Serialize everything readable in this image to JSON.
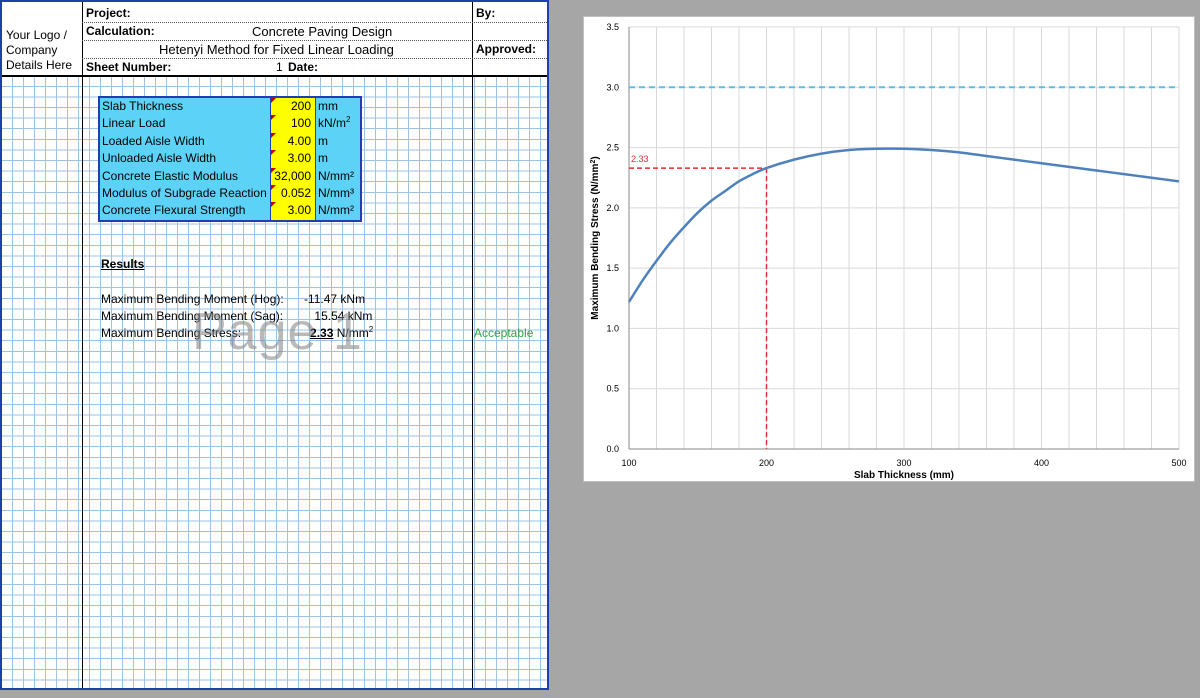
{
  "header": {
    "project_label": "Project:",
    "calculation_label": "Calculation:",
    "calculation_title": "Concrete Paving Design",
    "calculation_subtitle": "Hetenyi Method for Fixed Linear Loading",
    "sheet_number_label": "Sheet Number:",
    "sheet_number": "1",
    "date_label": "Date:",
    "by_label": "By:",
    "approved_label": "Approved:",
    "logo_lines": [
      "Your Logo /",
      "Company",
      "Details Here"
    ]
  },
  "inputs": [
    {
      "label": "Slab Thickness",
      "value": "200",
      "unit": "mm"
    },
    {
      "label": "Linear Load",
      "value": "100",
      "unit": "kN/m",
      "unit_sup": "2"
    },
    {
      "label": "Loaded Aisle Width",
      "value": "4.00",
      "unit": "m"
    },
    {
      "label": "Unloaded Aisle Width",
      "value": "3.00",
      "unit": "m"
    },
    {
      "label": "Concrete Elastic Modulus",
      "value": "32,000",
      "unit": "N/mm²"
    },
    {
      "label": "Modulus of Subgrade Reaction",
      "value": "0.052",
      "unit": "N/mm³"
    },
    {
      "label": "Concrete Flexural Strength",
      "value": "3.00",
      "unit": "N/mm²"
    }
  ],
  "results": {
    "title": "Results",
    "rows": [
      {
        "label": "Maximum Bending Moment (Hog):",
        "value": "-11.47",
        "unit": "kNm"
      },
      {
        "label": "Maximum Bending Moment (Sag):",
        "value": "15.54",
        "unit": "kNm"
      },
      {
        "label": "Maximum Bending Stress:",
        "value": "2.33",
        "unit": "N/mm",
        "unit_sup": "2"
      }
    ],
    "status": "Acceptable",
    "status_color": "#2ca24a"
  },
  "watermark": "Page 1",
  "chart_data": {
    "type": "line",
    "xlabel": "Slab Thickness  (mm)",
    "ylabel": "Maximum Bending Stress (N/mm",
    "ylabel_sup": "2",
    "ylabel_suffix": ")",
    "xlim": [
      100,
      500
    ],
    "ylim": [
      0,
      3.5
    ],
    "x_ticks": [
      "100",
      "200",
      "300",
      "400",
      "500"
    ],
    "y_ticks": [
      "0.0",
      "0.5",
      "1.0",
      "1.5",
      "2.0",
      "2.5",
      "3.0",
      "3.5"
    ],
    "grid": true,
    "series": [
      {
        "color": "#4f81bd",
        "x": [
          100,
          110,
          120,
          130,
          140,
          150,
          160,
          170,
          180,
          190,
          200,
          220,
          240,
          260,
          280,
          300,
          320,
          340,
          360,
          380,
          400,
          420,
          440,
          460,
          480,
          500
        ],
        "y": [
          1.22,
          1.4,
          1.56,
          1.71,
          1.84,
          1.96,
          2.06,
          2.14,
          2.22,
          2.28,
          2.33,
          2.4,
          2.45,
          2.48,
          2.49,
          2.49,
          2.48,
          2.46,
          2.43,
          2.4,
          2.37,
          2.34,
          2.31,
          2.28,
          2.25,
          2.22
        ]
      }
    ],
    "limit_line": {
      "y": 3.0,
      "color": "#5bc0de"
    },
    "design_point": {
      "x": 200,
      "y": 2.33,
      "label": "2.33",
      "color": "#e03030"
    }
  }
}
